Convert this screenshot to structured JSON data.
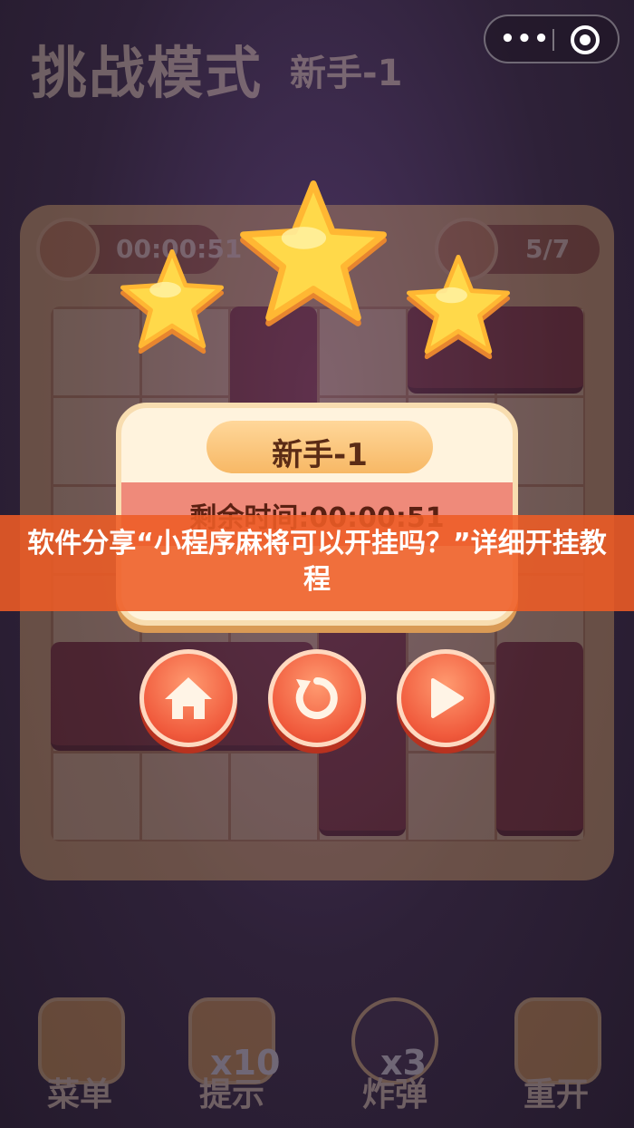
{
  "game": {
    "mode_title": "挑战模式",
    "level_title": "新手-1",
    "hud": {
      "timer_value": "00:00:51",
      "progress_value": "5/7"
    }
  },
  "result_panel": {
    "stars_earned": 3,
    "level_name": "新手-1",
    "remaining_time": "剩余时间:00:00:51"
  },
  "actions": {
    "home_icon": "home-icon",
    "restart_icon": "restart-icon",
    "next_icon": "play-icon"
  },
  "toolbar": {
    "items": [
      {
        "label": "菜单",
        "count": ""
      },
      {
        "label": "提示",
        "count": "x10"
      },
      {
        "label": "炸弹",
        "count": "x3"
      },
      {
        "label": "重开",
        "count": ""
      }
    ]
  },
  "capsule": {
    "more_label": "•••"
  },
  "banner": {
    "caption": "软件分享“小程序麻将可以开挂吗？”详细开挂教程"
  },
  "colors": {
    "accent": "#ee5c26",
    "star": "#ffd94a",
    "button": "#f05a3c"
  }
}
